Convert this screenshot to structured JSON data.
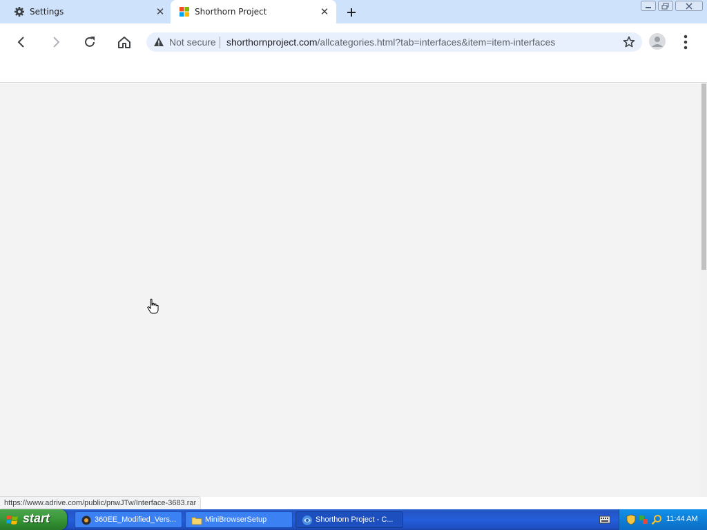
{
  "browser": {
    "tabs": [
      {
        "title": "Settings",
        "icon": "gear-icon"
      },
      {
        "title": "Shorthorn Project",
        "icon": "windows-logo-icon",
        "active": true
      }
    ],
    "address": {
      "security_label": "Not secure",
      "host": "shorthornproject.com",
      "path": "/allcategories.html?tab=interfaces&item=item-interfaces"
    },
    "status_url": "https://www.adrive.com/public/pnwJTw/Interface-3683.rar",
    "accent_color": "#cfe2fc",
    "content_background": "#f3f3f3"
  },
  "taskbar": {
    "start_label": "start",
    "items": [
      {
        "label": "360EE_Modified_Vers...",
        "icon": "app-icon"
      },
      {
        "label": "MiniBrowserSetup",
        "icon": "folder-icon"
      },
      {
        "label": "Shorthorn Project - C...",
        "icon": "browser-icon",
        "active": true
      }
    ],
    "clock": "11:44 AM"
  }
}
